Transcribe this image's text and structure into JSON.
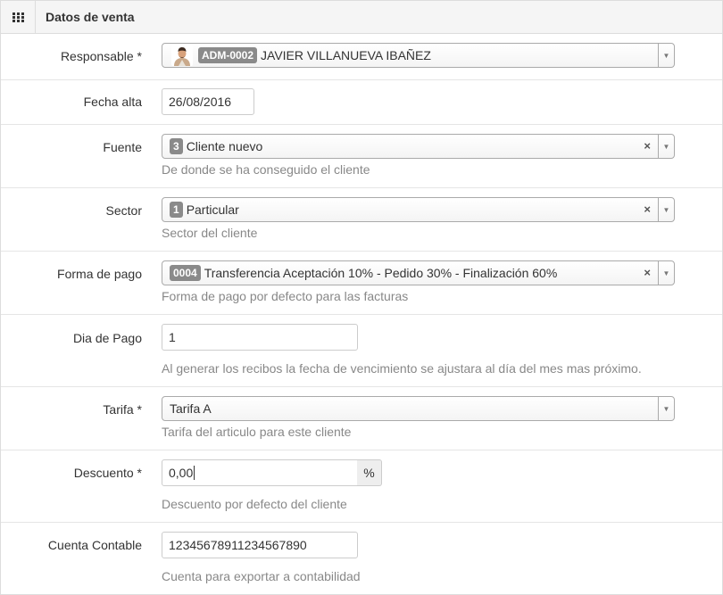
{
  "header": {
    "title": "Datos de venta",
    "icon": "grid-icon"
  },
  "fields": {
    "responsable": {
      "label": "Responsable *",
      "code": "ADM-0002",
      "value": "JAVIER VILLANUEVA IBAÑEZ"
    },
    "fecha_alta": {
      "label": "Fecha alta",
      "value": "26/08/2016"
    },
    "fuente": {
      "label": "Fuente",
      "code": "3",
      "value": "Cliente nuevo",
      "help": "De donde se ha conseguido el cliente"
    },
    "sector": {
      "label": "Sector",
      "code": "1",
      "value": "Particular",
      "help": "Sector del cliente"
    },
    "forma_pago": {
      "label": "Forma de pago",
      "code": "0004",
      "value": "Transferencia Aceptación 10% - Pedido 30% - Finalización 60%",
      "help": "Forma de pago por defecto para las facturas"
    },
    "dia_pago": {
      "label": "Dia de Pago",
      "value": "1",
      "help": "Al generar los recibos la fecha de vencimiento se ajustara al día del mes mas próximo."
    },
    "tarifa": {
      "label": "Tarifa *",
      "value": "Tarifa A",
      "help": "Tarifa del articulo para este cliente"
    },
    "descuento": {
      "label": "Descuento *",
      "value": "0,00",
      "addon": "%",
      "help": "Descuento por defecto del cliente"
    },
    "cuenta_contable": {
      "label": "Cuenta Contable",
      "value": "12345678911234567890",
      "help": "Cuenta para exportar a contabilidad"
    }
  },
  "glyphs": {
    "clear": "×",
    "dropdown": "▼"
  },
  "colors": {
    "badge": "#8a8a8a",
    "border": "#dddddd",
    "help_text": "#888888"
  }
}
